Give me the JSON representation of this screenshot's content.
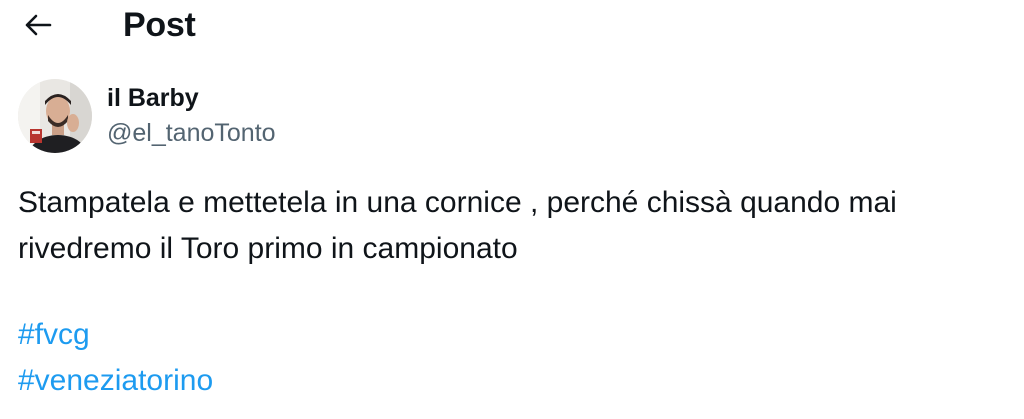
{
  "header": {
    "back_icon": "arrow-left-icon",
    "title": "Post"
  },
  "author": {
    "display_name": "il Barby",
    "handle": "@el_tanoTonto",
    "avatar_icon": "user-photo"
  },
  "tweet": {
    "line1": "Stampatela e mettetela in una cornice , perché chissà quando mai",
    "line2": "rivedremo il Toro primo in campionato",
    "hashtags": [
      "#fvcg",
      "#veneziatorino"
    ]
  },
  "colors": {
    "text": "#0f1419",
    "secondary": "#536471",
    "link": "#1d9bf0"
  }
}
